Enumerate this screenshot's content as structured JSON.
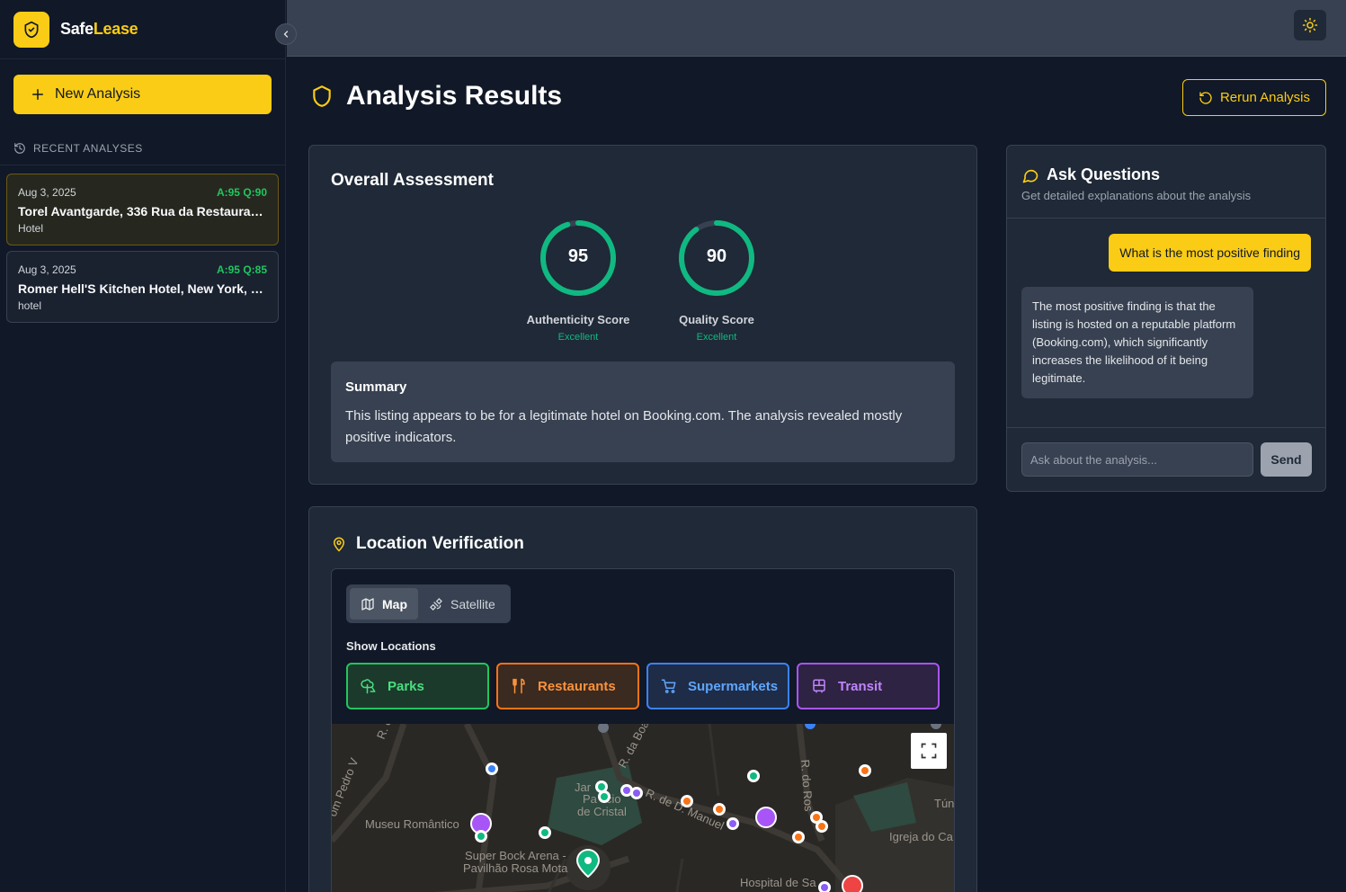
{
  "brand": {
    "name_a": "Safe",
    "name_b": "Lease"
  },
  "sidebar": {
    "new_analysis": "New Analysis",
    "recent_label": "RECENT ANALYSES",
    "recent": [
      {
        "date": "Aug 3, 2025",
        "scores": "A:95 Q:90",
        "title": "Torel Avantgarde, 336 Rua da Restauraçã...",
        "type": "Hotel"
      },
      {
        "date": "Aug 3, 2025",
        "scores": "A:95 Q:85",
        "title": "Romer Hell'S Kitchen Hotel, New York, Ne...",
        "type": "hotel"
      }
    ]
  },
  "header": {
    "title": "Analysis Results",
    "rerun": "Rerun Analysis"
  },
  "overall": {
    "title": "Overall Assessment",
    "authenticity": {
      "value": "95",
      "label": "Authenticity Score",
      "rating": "Excellent",
      "score": 95
    },
    "quality": {
      "value": "90",
      "label": "Quality Score",
      "rating": "Excellent",
      "score": 90
    },
    "summary_heading": "Summary",
    "summary_text": "This listing appears to be for a legitimate hotel on Booking.com. The analysis revealed mostly positive indicators."
  },
  "location": {
    "title": "Location Verification",
    "tab_map": "Map",
    "tab_satellite": "Satellite",
    "show_locations": "Show Locations",
    "filters": {
      "parks": "Parks",
      "restaurants": "Restaurants",
      "supermarkets": "Supermarkets",
      "transit": "Transit"
    },
    "map_labels": {
      "museu": "Museu Romântico",
      "jardins1": "Jar",
      "jardins2": "Pa",
      "jardins_s": "s",
      "jardins_cio": "cio",
      "cristal": "de Cristal",
      "super_bock": "Super Bock Arena -",
      "pavilhao": "Pavilhão Rosa Mota",
      "rua_manuel": "R. de D. Manuel",
      "rua_boa": "R. da Boa",
      "rua_ros": "R. do Ros",
      "pedro": "om Pedro V",
      "igreja": "Igreja do Ca",
      "hospital": "Hospital de Sa",
      "tun": "Tún",
      "r_c": "R. c"
    }
  },
  "ask": {
    "title": "Ask Questions",
    "subtitle": "Get detailed explanations about the analysis",
    "user_message": "What is the most positive finding",
    "bot_message": "The most positive finding is that the listing is hosted on a reputable platform (Booking.com), which significantly increases the likelihood of it being legitimate.",
    "input_placeholder": "Ask about the analysis...",
    "send": "Send"
  },
  "colors": {
    "accent": "#facc15",
    "score_green": "#10b981",
    "parks": "#22c55e",
    "restaurants": "#f97316",
    "supermarkets": "#3b82f6",
    "transit": "#a855f7"
  }
}
